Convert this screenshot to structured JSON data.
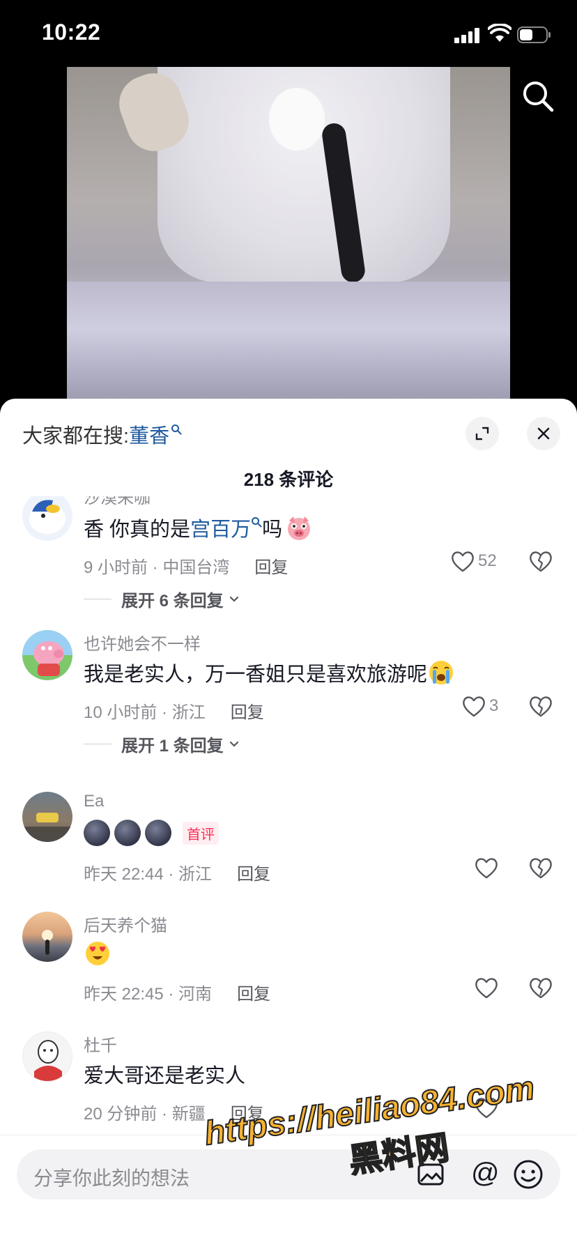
{
  "status_bar": {
    "time": "10:22"
  },
  "sheet": {
    "hot_search_prefix": "大家都在搜:",
    "hot_search_keyword": "董香",
    "comment_count": "218 条评论"
  },
  "comments": [
    {
      "user": "沙漠来咖",
      "text_parts": [
        "香  你真的是",
        "宫百万",
        "吗"
      ],
      "time_location": "9 小时前 · 中国台湾",
      "reply": "回复",
      "likes": "52",
      "expand": "展开 6 条回复"
    },
    {
      "user": "也许她会不一样",
      "text": "我是老实人，万一香姐只是喜欢旅游呢",
      "time_location": "10 小时前 · 浙江",
      "reply": "回复",
      "likes": "3",
      "expand": "展开 1 条回复"
    },
    {
      "user": "Ea",
      "badge": "首评",
      "time_location": "昨天 22:44 · 浙江",
      "reply": "回复"
    },
    {
      "user": "后天养个猫",
      "time_location": "昨天 22:45 · 河南",
      "reply": "回复"
    },
    {
      "user": "杜千",
      "text": "爱大哥还是老实人",
      "time_location": "20 分钟前 · 新疆",
      "reply": "回复"
    }
  ],
  "input": {
    "placeholder": "分享你此刻的想法",
    "at_label": "@"
  },
  "watermark": {
    "url": "https://heiliao84.com",
    "name": "黑料网"
  },
  "colors": {
    "link": "#1f5a9e",
    "first_badge": "#fe2c55",
    "watermark": "#f7b231"
  }
}
